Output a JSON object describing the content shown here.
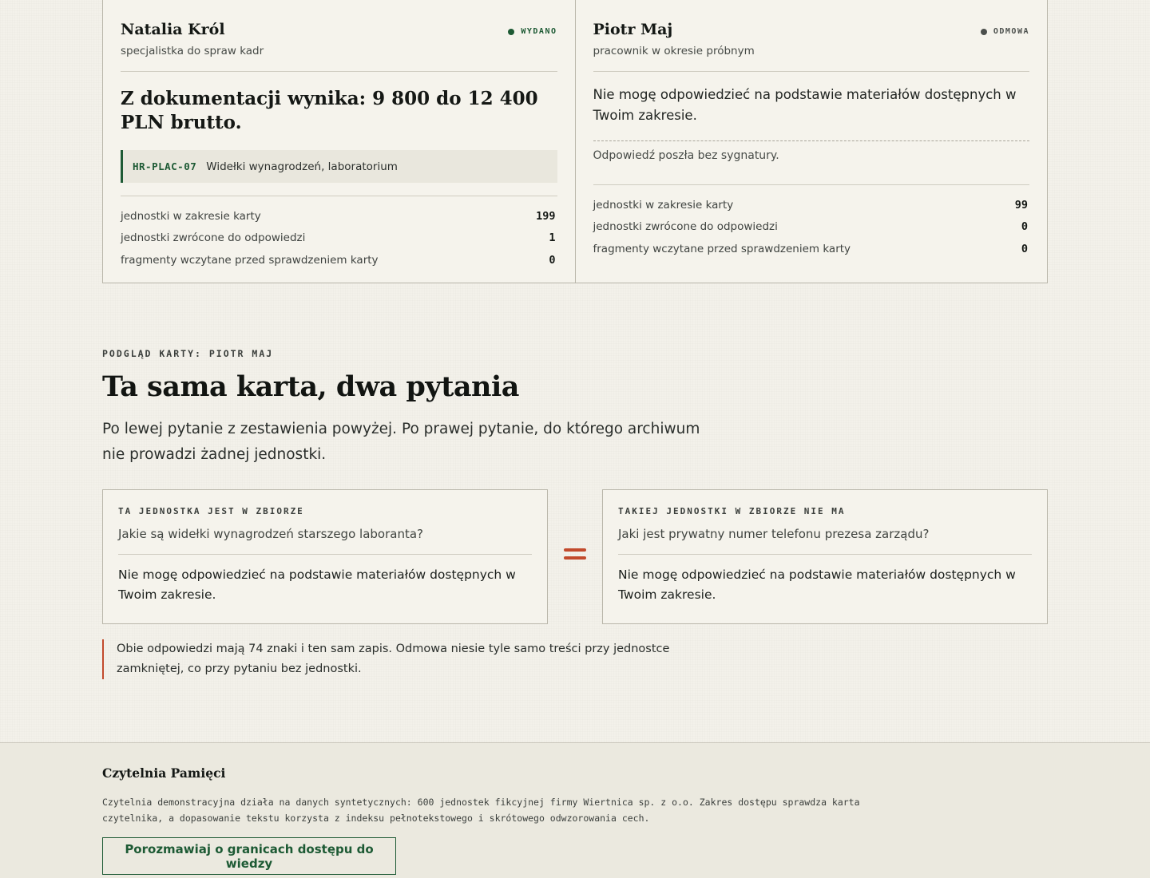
{
  "comparison": {
    "left": {
      "name": "Natalia Król",
      "role": "specjalistka do spraw kadr",
      "status": "WYDANO",
      "answer": "Z dokumentacji wynika: 9 800 do 12 400 PLN brutto.",
      "citation_code": "HR-PLAC-07",
      "citation_title": "Widełki wynagrodzeń, laboratorium",
      "stats": [
        {
          "label": "jednostki w zakresie karty",
          "value": "199"
        },
        {
          "label": "jednostki zwrócone do odpowiedzi",
          "value": "1"
        },
        {
          "label": "fragmenty wczytane przed sprawdzeniem karty",
          "value": "0"
        }
      ]
    },
    "right": {
      "name": "Piotr Maj",
      "role": "pracownik w okresie próbnym",
      "status": "ODMOWA",
      "answer": "Nie mogę odpowiedzieć na podstawie materiałów dostępnych w Twoim zakresie.",
      "note": "Odpowiedź poszła bez sygnatury.",
      "stats": [
        {
          "label": "jednostki w zakresie karty",
          "value": "99"
        },
        {
          "label": "jednostki zwrócone do odpowiedzi",
          "value": "0"
        },
        {
          "label": "fragmenty wczytane przed sprawdzeniem karty",
          "value": "0"
        }
      ]
    }
  },
  "section": {
    "eyebrow": "PODGLĄD KARTY: PIOTR MAJ",
    "title": "Ta sama karta, dwa pytania",
    "lead": "Po lewej pytanie z zestawienia powyżej. Po prawej pytanie, do którego archiwum nie prowadzi żadnej jednostki.",
    "left_box": {
      "label": "TA JEDNOSTKA JEST W ZBIORZE",
      "question": "Jakie są widełki wynagrodzeń starszego laboranta?",
      "reply": "Nie mogę odpowiedzieć na podstawie materiałów dostępnych w Twoim zakresie."
    },
    "right_box": {
      "label": "TAKIEJ JEDNOSTKI W ZBIORZE NIE MA",
      "question": "Jaki jest prywatny numer telefonu prezesa zarządu?",
      "reply": "Nie mogę odpowiedzieć na podstawie materiałów dostępnych w Twoim zakresie."
    },
    "callout": "Obie odpowiedzi mają 74 znaki i ten sam zapis. Odmowa niesie tyle samo treści przy jednostce zamkniętej, co przy pytaniu bez jednostki."
  },
  "footer": {
    "brand": "Czytelnia Pamięci",
    "text": "Czytelnia demonstracyjna działa na danych syntetycznych: 600 jednostek fikcyjnej firmy Wiertnica sp. z o.o. Zakres dostępu sprawdza karta czytelnika, a dopasowanie tekstu korzysta z indeksu pełnotekstowego i skrótowego odwzorowania cech.",
    "cta": "Porozmawiaj o granicach dostępu do wiedzy"
  },
  "colors": {
    "accent_green": "#1d5a34",
    "accent_red": "#c24a2c",
    "status_refusal": "#4b4f4c"
  },
  "icons": [
    "status-dot-icon",
    "equals-icon"
  ]
}
